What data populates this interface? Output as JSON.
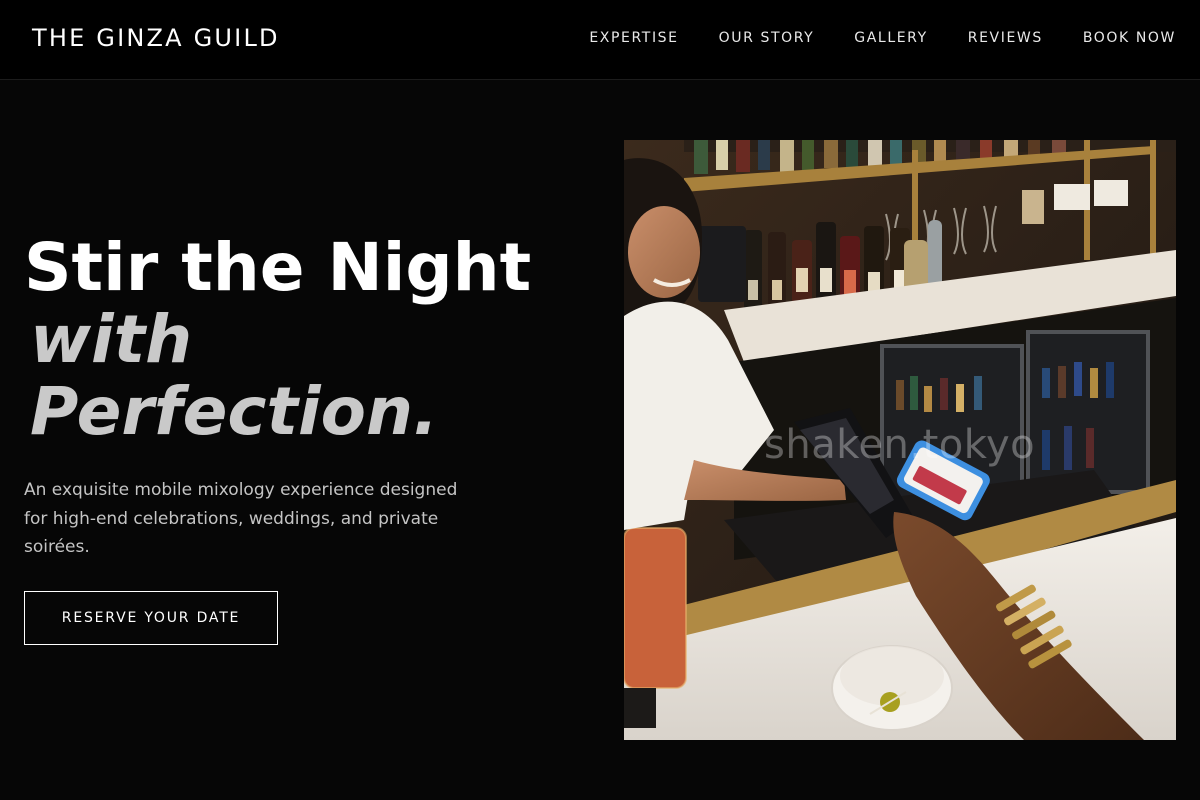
{
  "brand": "THE GINZA GUILD",
  "nav": {
    "items": [
      "EXPERTISE",
      "OUR STORY",
      "GALLERY",
      "REVIEWS",
      "BOOK NOW"
    ]
  },
  "hero": {
    "title_line1": "Stir the Night",
    "title_line2": "with",
    "title_line3": "Perfection.",
    "description": "An exquisite mobile mixology experience designed for high-end celebrations, weddings, and private soirées.",
    "cta_label": "RESERVE YOUR DATE"
  },
  "photo": {
    "watermark": "shaken.tokyo",
    "subject": "bartender-taking-phone-payment"
  },
  "colors": {
    "background": "#060606",
    "header": "#000000",
    "text": "#ffffff",
    "muted_text": "#c4c4c4"
  }
}
